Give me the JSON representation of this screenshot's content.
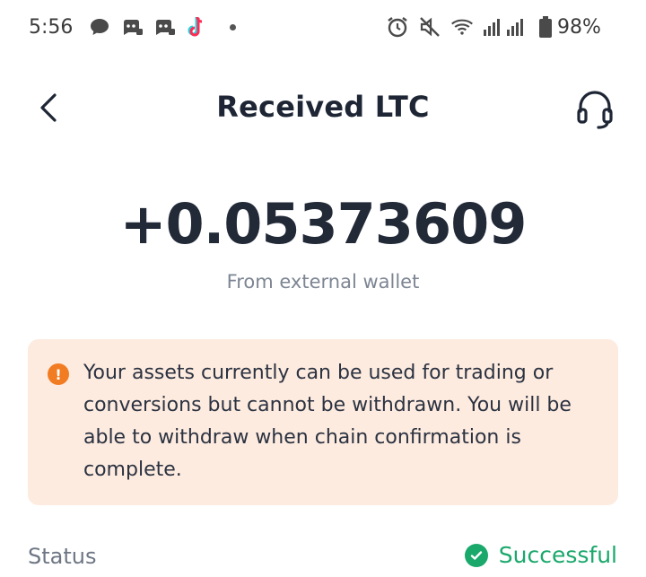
{
  "status_bar": {
    "time": "5:56",
    "battery_pct": "98%",
    "left_icons": [
      "chat-bubble-icon",
      "discord-icon",
      "discord-icon",
      "tiktok-icon"
    ],
    "right_icons": [
      "alarm-icon",
      "mute-icon",
      "wifi-icon",
      "signal-icon",
      "battery-icon"
    ]
  },
  "header": {
    "title": "Received LTC"
  },
  "transaction": {
    "amount": "+0.05373609",
    "source": "From external wallet"
  },
  "notice": {
    "text": "Your assets currently can be used for trading or conversions but cannot be withdrawn. You will be able to withdraw when chain confirmation is complete.",
    "accent": "#f27c22",
    "background": "#fdebe0"
  },
  "details": {
    "status_label": "Status",
    "status_value": "Successful",
    "status_color": "#1aa86b"
  }
}
